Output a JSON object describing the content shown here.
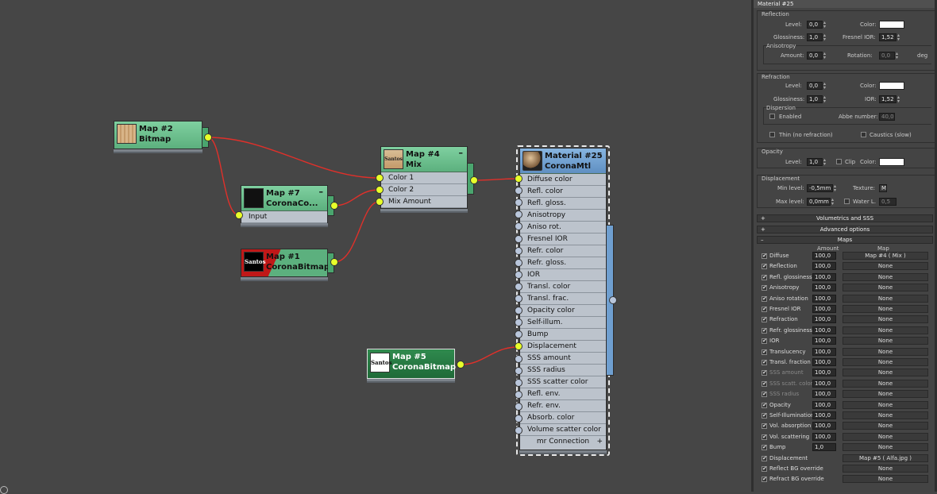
{
  "nodes": {
    "map2": {
      "title": "Map #2",
      "type": "Bitmap"
    },
    "map7": {
      "title": "Map #7",
      "type": "CoronaCo...",
      "input": "Input"
    },
    "map1": {
      "title": "Map #1",
      "type": "CoronaBitmap",
      "thumb": "Santos"
    },
    "map4": {
      "title": "Map #4",
      "type": "Mix",
      "thumb": "Santos",
      "slots": [
        "Color 1",
        "Color 2",
        "Mix Amount"
      ]
    },
    "map5": {
      "title": "Map #5",
      "type": "CoronaBitmap",
      "thumb": "Santos"
    },
    "mat25": {
      "title": "Material #25",
      "type": "CoronaMtl",
      "slots": [
        "Diffuse color",
        "Refl. color",
        "Refl. gloss.",
        "Anisotropy",
        "Aniso rot.",
        "Fresnel IOR",
        "Refr. color",
        "Refr. gloss.",
        "IOR",
        "Transl. color",
        "Transl. frac.",
        "Opacity color",
        "Self-illum.",
        "Bump",
        "Displacement",
        "SSS amount",
        "SSS radius",
        "SSS scatter color",
        "Refl. env.",
        "Refr. env.",
        "Absorb. color",
        "Volume scatter color"
      ],
      "footer": "mr Connection"
    }
  },
  "panel": {
    "title": "Material #25",
    "reflection": {
      "label": "Reflection",
      "level_label": "Level:",
      "level": "0,0",
      "color_label": "Color:",
      "gloss_label": "Glossiness:",
      "gloss": "1,0",
      "fresnel_label": "Fresnel IOR:",
      "fresnel": "1,52",
      "aniso_label": "Anisotropy",
      "amount_label": "Amount:",
      "amount": "0,0",
      "rotation_label": "Rotation:",
      "rotation": "0,0",
      "deg": "deg"
    },
    "refraction": {
      "label": "Refraction",
      "level_label": "Level:",
      "level": "0,0",
      "color_label": "Color:",
      "gloss_label": "Glossiness:",
      "gloss": "1,0",
      "ior_label": "IOR:",
      "ior": "1,52",
      "dispersion_label": "Dispersion",
      "enabled_label": "Enabled",
      "abbe_label": "Abbe number:",
      "abbe": "40,0",
      "thin_label": "Thin (no refraction)",
      "caustics_label": "Caustics (slow)"
    },
    "opacity": {
      "label": "Opacity",
      "level_label": "Level:",
      "level": "1,0",
      "clip_label": "Clip",
      "color_label": "Color:"
    },
    "displacement": {
      "label": "Displacement",
      "min_label": "Min level:",
      "min": "-0,5mm",
      "texture_label": "Texture:",
      "texture_btn": "M",
      "max_label": "Max level:",
      "max": "0,0mm",
      "water_label": "Water L.",
      "water": "0,5"
    },
    "rollouts": {
      "vol": "Volumetrics and SSS",
      "adv": "Advanced options",
      "maps": "Maps"
    },
    "maps": {
      "amount_header": "Amount",
      "map_header": "Map",
      "rows": [
        {
          "name": "Diffuse",
          "amount": "100,0",
          "map": "Map #4  ( Mix )",
          "dim": false
        },
        {
          "name": "Reflection",
          "amount": "100,0",
          "map": "None",
          "dim": false
        },
        {
          "name": "Refl. glossiness",
          "amount": "100,0",
          "map": "None",
          "dim": false
        },
        {
          "name": "Anisotropy",
          "amount": "100,0",
          "map": "None",
          "dim": false
        },
        {
          "name": "Aniso rotation",
          "amount": "100,0",
          "map": "None",
          "dim": false
        },
        {
          "name": "Fresnel IOR",
          "amount": "100,0",
          "map": "None",
          "dim": false
        },
        {
          "name": "Refraction",
          "amount": "100,0",
          "map": "None",
          "dim": false
        },
        {
          "name": "Refr. glossiness",
          "amount": "100,0",
          "map": "None",
          "dim": false
        },
        {
          "name": "IOR",
          "amount": "100,0",
          "map": "None",
          "dim": false
        },
        {
          "name": "Translucency",
          "amount": "100,0",
          "map": "None",
          "dim": false
        },
        {
          "name": "Transl. fraction",
          "amount": "100,0",
          "map": "None",
          "dim": false
        },
        {
          "name": "SSS amount",
          "amount": "100,0",
          "map": "None",
          "dim": true
        },
        {
          "name": "SSS scatt. color",
          "amount": "100,0",
          "map": "None",
          "dim": true
        },
        {
          "name": "SSS radius",
          "amount": "100,0",
          "map": "None",
          "dim": true
        },
        {
          "name": "Opacity",
          "amount": "100,0",
          "map": "None",
          "dim": false
        },
        {
          "name": "Self-Illumination",
          "amount": "100,0",
          "map": "None",
          "dim": false
        },
        {
          "name": "Vol. absorption",
          "amount": "100,0",
          "map": "None",
          "dim": false
        },
        {
          "name": "Vol. scattering",
          "amount": "100,0",
          "map": "None",
          "dim": false
        },
        {
          "name": "Bump",
          "amount": "1,0",
          "map": "None",
          "dim": false
        },
        {
          "name": "Displacement",
          "amount": "",
          "map": "Map #5 ( Alfa.jpg )",
          "dim": false
        },
        {
          "name": "Reflect BG override",
          "amount": "",
          "map": "None",
          "dim": false
        },
        {
          "name": "Refract BG override",
          "amount": "",
          "map": "None",
          "dim": false
        }
      ]
    }
  },
  "colors": {
    "wire": "#e0302a",
    "socket_active": "#e8ff2a",
    "node_green": "#6cc08e",
    "node_blue": "#6f9fd0"
  }
}
